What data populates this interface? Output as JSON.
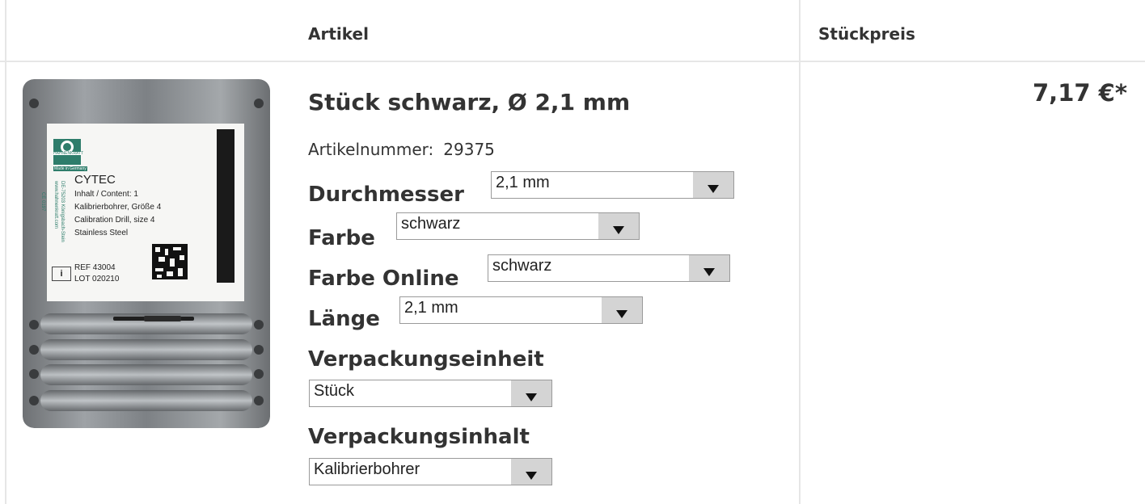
{
  "table": {
    "header_article": "Artikel",
    "header_unit_price": "Stückpreis"
  },
  "product": {
    "title": "Stück schwarz, Ø 2,1 mm",
    "article_number_label": "Artikelnummer:",
    "article_number": "29375",
    "price": "7,17 €*",
    "image": {
      "brand": "HAHNENKRATT",
      "made_in": "Made in Germany",
      "name": "CYTEC",
      "content": "Inhalt / Content: 1",
      "desc_de": "Kalibrierbohrer, Größe 4",
      "desc_en": "Calibration Drill, size 4",
      "material": "Stainless Steel",
      "ce": "CE 0197",
      "website": "www.hahnenkratt.com",
      "address": "DE-75203 Königsbach-Stein",
      "ref": "REF 43004",
      "lot": "LOT 020210"
    }
  },
  "options": {
    "diameter": {
      "label": "Durchmesser",
      "value": "2,1 mm"
    },
    "color": {
      "label": "Farbe",
      "value": "schwarz"
    },
    "color_online": {
      "label": "Farbe Online",
      "value": "schwarz"
    },
    "length": {
      "label": "Länge",
      "value": "2,1 mm"
    },
    "packaging_unit": {
      "label": "Verpackungseinheit",
      "value": "Stück"
    },
    "packaging_content": {
      "label": "Verpackungsinhalt",
      "value": "Kalibrierbohrer"
    }
  },
  "colors": {
    "text": "#333333",
    "grid": "#e6e6e6",
    "select_button": "#d4d4d4",
    "logo_green": "#2e7d6b"
  }
}
